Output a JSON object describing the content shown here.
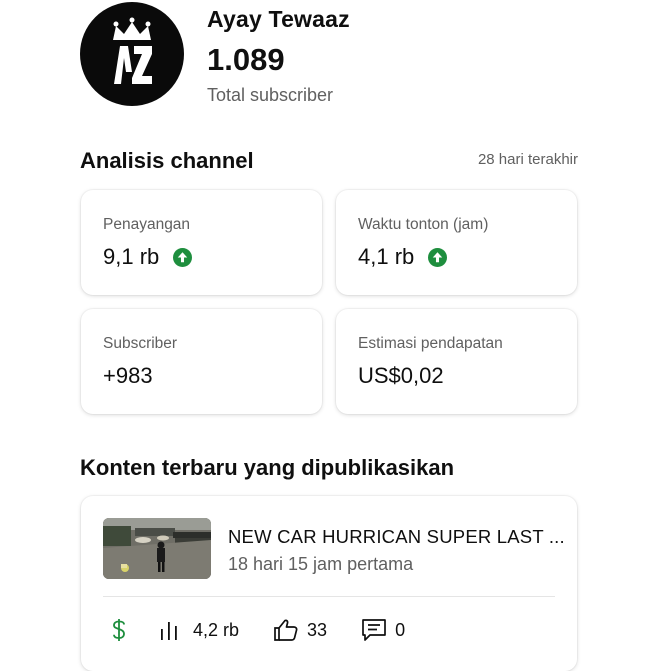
{
  "channel": {
    "name": "Ayay Tewaaz",
    "subscriber_count": "1.089",
    "subscriber_label": "Total subscriber",
    "avatar_text": "AZ"
  },
  "analytics": {
    "title": "Analisis channel",
    "range": "28 hari terakhir",
    "metrics": [
      {
        "label": "Penayangan",
        "value": "9,1 rb",
        "trend": "up"
      },
      {
        "label": "Waktu tonton (jam)",
        "value": "4,1 rb",
        "trend": "up"
      },
      {
        "label": "Subscriber",
        "value": "+983",
        "trend": "none"
      },
      {
        "label": "Estimasi pendapatan",
        "value": "US$0,02",
        "trend": "none"
      }
    ]
  },
  "recent": {
    "title": "Konten terbaru yang dipublikasikan",
    "video": {
      "title": "NEW CAR HURRICAN SUPER LAST ...",
      "meta": "18 hari 15 jam pertama",
      "views": "4,2 rb",
      "likes": "33",
      "comments": "0"
    }
  },
  "colors": {
    "trend_up": "#1e8e3e",
    "revenue_icon": "#1e8e3e",
    "secondary_text": "#606060"
  }
}
